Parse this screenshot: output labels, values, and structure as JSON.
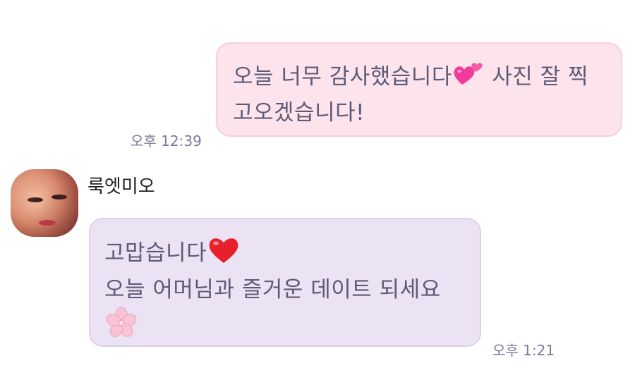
{
  "conversation": {
    "sent_message": {
      "line1_before": "오늘 너무 감사했습니다",
      "line1_emoji": "two-hearts",
      "line1_after": " 사진 잘 찍",
      "line2": "고오겠습니다!",
      "time": "오후 12:39"
    },
    "received_message": {
      "sender_name": "룩엣미오",
      "line1": "고맙습니다",
      "line1_emoji": "red-heart",
      "line2": "오늘 어머님과 즐거운 데이트 되세요",
      "line3_emoji": "cherry-blossom",
      "time": "오후 1:21"
    }
  },
  "colors": {
    "sent_bubble": "#fde3ec",
    "received_bubble": "#ebe2f3",
    "message_text": "#5d5b78",
    "timestamp_text": "#7b7892"
  }
}
